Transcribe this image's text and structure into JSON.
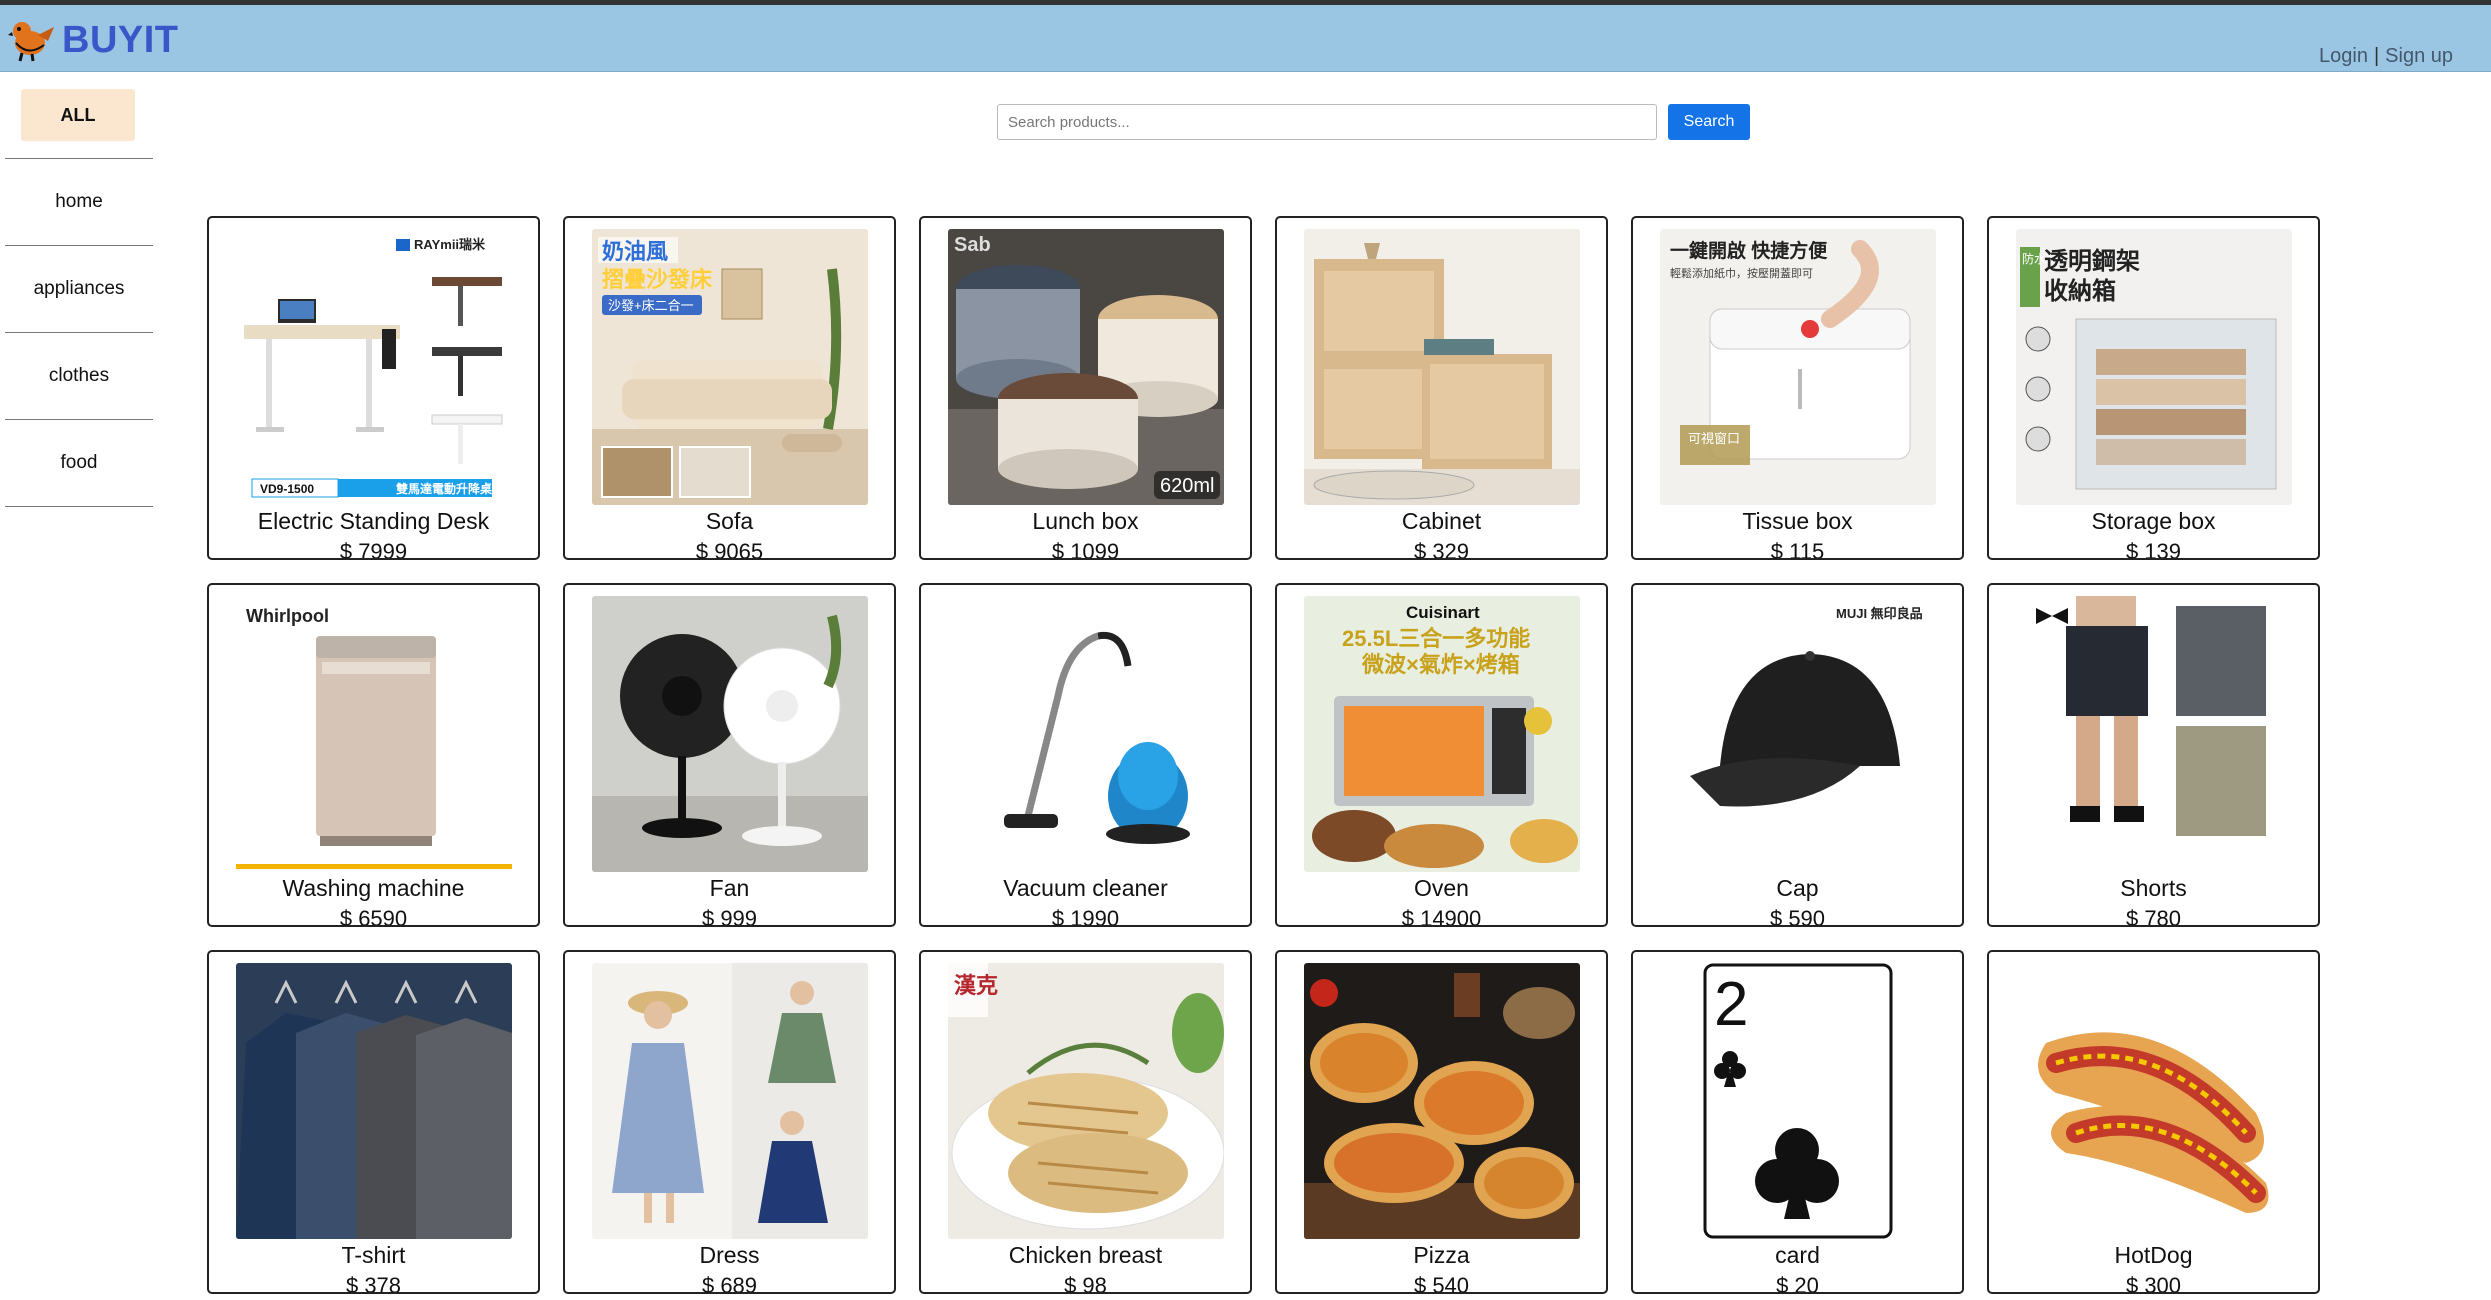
{
  "brand": {
    "name": "BUYIT",
    "logo_icon": "bird-logo-icon"
  },
  "auth": {
    "login": "Login",
    "separator": "|",
    "signup": "Sign up"
  },
  "sidebar": {
    "all_label": "ALL",
    "items": [
      {
        "label": "home"
      },
      {
        "label": "appliances"
      },
      {
        "label": "clothes"
      },
      {
        "label": "food"
      }
    ]
  },
  "search": {
    "placeholder": "Search products...",
    "button_label": "Search"
  },
  "products": [
    {
      "name": "Electric Standing Desk",
      "price": "$ 7999"
    },
    {
      "name": "Sofa",
      "price": "$ 9065"
    },
    {
      "name": "Lunch box",
      "price": "$ 1099"
    },
    {
      "name": "Cabinet",
      "price": "$ 329"
    },
    {
      "name": "Tissue box",
      "price": "$ 115"
    },
    {
      "name": "Storage box",
      "price": "$ 139"
    },
    {
      "name": "Washing machine",
      "price": "$ 6590"
    },
    {
      "name": "Fan",
      "price": "$ 999"
    },
    {
      "name": "Vacuum cleaner",
      "price": "$ 1990"
    },
    {
      "name": "Oven",
      "price": "$ 14900"
    },
    {
      "name": "Cap",
      "price": "$ 590"
    },
    {
      "name": "Shorts",
      "price": "$ 780"
    },
    {
      "name": "T-shirt",
      "price": "$ 378"
    },
    {
      "name": "Dress",
      "price": "$ 689"
    },
    {
      "name": "Chicken breast",
      "price": "$ 98"
    },
    {
      "name": "Pizza",
      "price": "$ 540"
    },
    {
      "name": "card",
      "price": "$ 20"
    },
    {
      "name": "HotDog",
      "price": "$ 300"
    }
  ],
  "image_text": {
    "desk_brand": "RAYmii瑞米",
    "desk_model": "VD9-1500",
    "desk_caption": "雙馬達電動升降桌",
    "sofa_title": "奶油風",
    "sofa_subtitle": "摺疊沙發床",
    "sofa_tag": "沙發+床二合一",
    "lunch_brand": "Sab",
    "lunch_size": "620ml",
    "tissue_title": "一鍵開啟 快捷方便",
    "tissue_sub": "輕鬆添加紙巾，按壓開蓋即可",
    "tissue_window": "可視窗口",
    "storage_tag": "防水款",
    "storage_title": "透明鋼架",
    "storage_title2": "收納箱",
    "washer_brand": "Whirlpool",
    "oven_brand": "Cuisinart",
    "oven_line1": "25.5L三合一多功能",
    "oven_line2": "微波×氣炸×烤箱",
    "cap_brand": "MUJI 無印良品",
    "chicken_brand": "漢克",
    "card_rank": "2"
  }
}
